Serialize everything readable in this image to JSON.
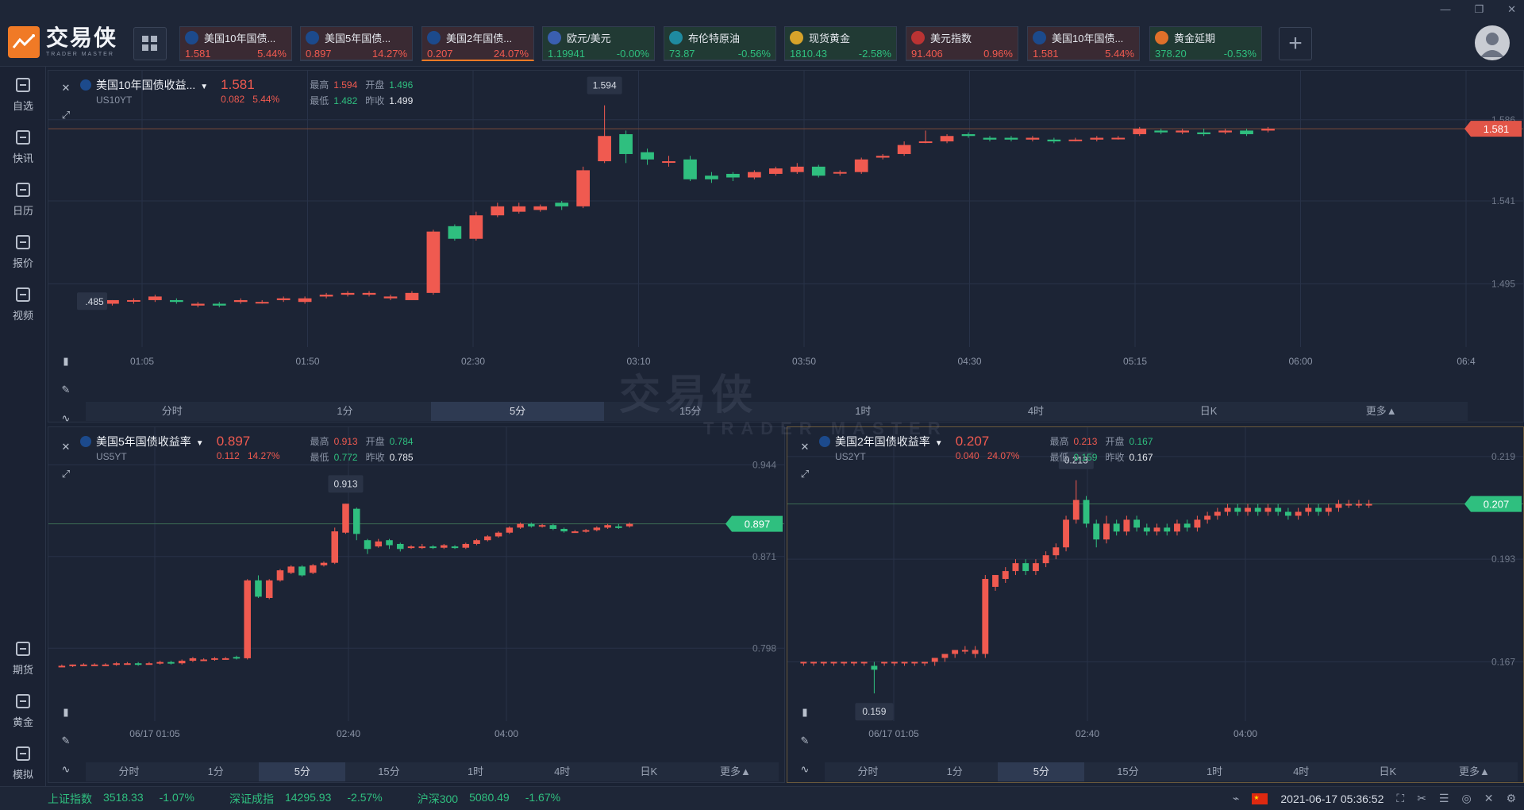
{
  "app": {
    "logo_cn": "交易侠",
    "logo_en": "TRADER MASTER",
    "watermark_cn": "交易侠",
    "watermark_en": "TRADER MASTER"
  },
  "tickers": [
    {
      "name": "美国10年国债...",
      "price": "1.581",
      "change": "5.44%",
      "dir": "up",
      "icon": "bar-chart-icon",
      "active": false
    },
    {
      "name": "美国5年国债...",
      "price": "0.897",
      "change": "14.27%",
      "dir": "up",
      "icon": "bar-chart-icon",
      "active": false
    },
    {
      "name": "美国2年国债...",
      "price": "0.207",
      "change": "24.07%",
      "dir": "up",
      "icon": "bar-chart-icon",
      "active": true
    },
    {
      "name": "欧元/美元",
      "price": "1.19941",
      "change": "-0.00%",
      "dir": "dn",
      "icon": "eu-us-flag-icon",
      "active": false
    },
    {
      "name": "布伦特原油",
      "price": "73.87",
      "change": "-0.56%",
      "dir": "dn",
      "icon": "oil-icon",
      "active": false
    },
    {
      "name": "现货黄金",
      "price": "1810.43",
      "change": "-2.58%",
      "dir": "dn",
      "icon": "gold-icon",
      "active": false
    },
    {
      "name": "美元指数",
      "price": "91.406",
      "change": "0.96%",
      "dir": "up",
      "icon": "us-flag-icon",
      "active": false
    },
    {
      "name": "美国10年国债...",
      "price": "1.581",
      "change": "5.44%",
      "dir": "up",
      "icon": "bar-chart-icon",
      "active": false
    },
    {
      "name": "黄金延期",
      "price": "378.20",
      "change": "-0.53%",
      "dir": "dn",
      "icon": "gold-bar-icon",
      "active": false
    }
  ],
  "sidebar_top": [
    {
      "label": "自选",
      "icon": "watchlist-icon"
    },
    {
      "label": "快讯",
      "icon": "news-icon"
    },
    {
      "label": "日历",
      "icon": "calendar-icon"
    },
    {
      "label": "报价",
      "icon": "quote-icon"
    },
    {
      "label": "视频",
      "icon": "video-icon"
    }
  ],
  "sidebar_bottom": [
    {
      "label": "期货",
      "icon": "futures-icon"
    },
    {
      "label": "黄金",
      "icon": "gold-icon"
    },
    {
      "label": "模拟",
      "icon": "simulate-icon"
    }
  ],
  "labels": {
    "high": "最高",
    "low": "最低",
    "open": "开盘",
    "prev": "昨收"
  },
  "panels": [
    {
      "title": "美国10年国债收益...",
      "code": "US10YT",
      "price": "1.581",
      "chg": "0.082",
      "pct": "5.44%",
      "high": "1.594",
      "low": "1.482",
      "open": "1.496",
      "prev": "1.499",
      "y_ticks": [
        "1.586",
        "1.541",
        "1.495"
      ],
      "x_ticks": [
        "01:05",
        "01:50",
        "02:30",
        "03:10",
        "03:50",
        "04:30",
        "05:15",
        "06:00",
        "06:4"
      ],
      "last_tag": "1.581",
      "high_tag": "1.594",
      "low_tag": ".485",
      "timeframes": [
        "分时",
        "1分",
        "5分",
        "15分",
        "1时",
        "4时",
        "日K",
        "更多▲"
      ],
      "selected_tf": "5分"
    },
    {
      "title": "美国5年国债收益率",
      "code": "US5YT",
      "price": "0.897",
      "chg": "0.112",
      "pct": "14.27%",
      "high": "0.913",
      "low": "0.772",
      "open": "0.784",
      "prev": "0.785",
      "y_ticks": [
        "0.944",
        "0.871",
        "0.798"
      ],
      "x_ticks": [
        "06/17 01:05",
        "02:40",
        "04:00"
      ],
      "last_tag": "0.897",
      "high_tag": "0.913",
      "low_tag": "",
      "timeframes": [
        "分时",
        "1分",
        "5分",
        "15分",
        "1时",
        "4时",
        "日K",
        "更多▲"
      ],
      "selected_tf": "5分"
    },
    {
      "title": "美国2年国债收益率",
      "code": "US2YT",
      "price": "0.207",
      "chg": "0.040",
      "pct": "24.07%",
      "high": "0.213",
      "low": "0.159",
      "open": "0.167",
      "prev": "0.167",
      "y_ticks": [
        "0.219",
        "0.193",
        "0.167"
      ],
      "x_ticks": [
        "06/17 01:05",
        "02:40",
        "04:00"
      ],
      "last_tag": "0.207",
      "high_tag": "0.213",
      "low_tag": "0.159",
      "timeframes": [
        "分时",
        "1分",
        "5分",
        "15分",
        "1时",
        "4时",
        "日K",
        "更多▲"
      ],
      "selected_tf": "5分"
    }
  ],
  "chart_data": [
    {
      "type": "candlestick",
      "title": "美国10年国债收益率",
      "ylim": [
        1.46,
        1.6
      ],
      "candles": [
        [
          1.483,
          1.484,
          1.483,
          1.485
        ],
        [
          1.484,
          1.486,
          1.483,
          1.486
        ],
        [
          1.486,
          1.486,
          1.484,
          1.487
        ],
        [
          1.486,
          1.488,
          1.485,
          1.489
        ],
        [
          1.486,
          1.485,
          1.484,
          1.487
        ],
        [
          1.483,
          1.484,
          1.482,
          1.485
        ],
        [
          1.484,
          1.483,
          1.482,
          1.485
        ],
        [
          1.485,
          1.486,
          1.484,
          1.487
        ],
        [
          1.485,
          1.485,
          1.484,
          1.486
        ],
        [
          1.486,
          1.487,
          1.485,
          1.488
        ],
        [
          1.485,
          1.487,
          1.484,
          1.488
        ],
        [
          1.488,
          1.489,
          1.487,
          1.49
        ],
        [
          1.489,
          1.49,
          1.488,
          1.491
        ],
        [
          1.489,
          1.49,
          1.488,
          1.491
        ],
        [
          1.487,
          1.488,
          1.486,
          1.489
        ],
        [
          1.486,
          1.49,
          1.486,
          1.491
        ],
        [
          1.49,
          1.524,
          1.489,
          1.525
        ],
        [
          1.527,
          1.52,
          1.519,
          1.528
        ],
        [
          1.52,
          1.533,
          1.519,
          1.535
        ],
        [
          1.533,
          1.538,
          1.532,
          1.54
        ],
        [
          1.535,
          1.538,
          1.534,
          1.54
        ],
        [
          1.536,
          1.538,
          1.535,
          1.539
        ],
        [
          1.54,
          1.538,
          1.536,
          1.541
        ],
        [
          1.538,
          1.558,
          1.537,
          1.56
        ],
        [
          1.563,
          1.577,
          1.562,
          1.594
        ],
        [
          1.578,
          1.567,
          1.562,
          1.58
        ],
        [
          1.568,
          1.564,
          1.561,
          1.57
        ],
        [
          1.563,
          1.563,
          1.56,
          1.566
        ],
        [
          1.564,
          1.553,
          1.552,
          1.566
        ],
        [
          1.555,
          1.553,
          1.551,
          1.557
        ],
        [
          1.556,
          1.554,
          1.552,
          1.557
        ],
        [
          1.554,
          1.557,
          1.553,
          1.558
        ],
        [
          1.556,
          1.559,
          1.555,
          1.56
        ],
        [
          1.557,
          1.56,
          1.556,
          1.562
        ],
        [
          1.56,
          1.555,
          1.554,
          1.561
        ],
        [
          1.557,
          1.557,
          1.555,
          1.558
        ],
        [
          1.557,
          1.564,
          1.556,
          1.565
        ],
        [
          1.565,
          1.566,
          1.564,
          1.567
        ],
        [
          1.567,
          1.572,
          1.566,
          1.574
        ],
        [
          1.574,
          1.574,
          1.573,
          1.58
        ],
        [
          1.574,
          1.577,
          1.573,
          1.578
        ],
        [
          1.578,
          1.577,
          1.576,
          1.579
        ],
        [
          1.576,
          1.575,
          1.574,
          1.577
        ],
        [
          1.576,
          1.575,
          1.574,
          1.577
        ],
        [
          1.575,
          1.576,
          1.574,
          1.577
        ],
        [
          1.575,
          1.574,
          1.573,
          1.576
        ],
        [
          1.575,
          1.575,
          1.574,
          1.576
        ],
        [
          1.575,
          1.576,
          1.574,
          1.577
        ],
        [
          1.576,
          1.576,
          1.575,
          1.577
        ],
        [
          1.578,
          1.581,
          1.577,
          1.582
        ],
        [
          1.58,
          1.579,
          1.578,
          1.581
        ],
        [
          1.579,
          1.58,
          1.578,
          1.581
        ],
        [
          1.579,
          1.578,
          1.577,
          1.581
        ],
        [
          1.579,
          1.58,
          1.578,
          1.581
        ],
        [
          1.58,
          1.578,
          1.577,
          1.581
        ],
        [
          1.58,
          1.581,
          1.579,
          1.582
        ]
      ]
    },
    {
      "type": "candlestick",
      "title": "美国5年国债收益率",
      "ylim": [
        0.74,
        0.96
      ],
      "candles": [
        [
          0.784,
          0.784,
          0.783,
          0.785
        ],
        [
          0.784,
          0.785,
          0.783,
          0.785
        ],
        [
          0.785,
          0.785,
          0.784,
          0.786
        ],
        [
          0.784,
          0.785,
          0.784,
          0.786
        ],
        [
          0.785,
          0.785,
          0.784,
          0.786
        ],
        [
          0.785,
          0.786,
          0.784,
          0.787
        ],
        [
          0.786,
          0.786,
          0.785,
          0.787
        ],
        [
          0.786,
          0.785,
          0.784,
          0.787
        ],
        [
          0.786,
          0.786,
          0.785,
          0.787
        ],
        [
          0.786,
          0.787,
          0.785,
          0.788
        ],
        [
          0.787,
          0.786,
          0.785,
          0.788
        ],
        [
          0.786,
          0.788,
          0.785,
          0.789
        ],
        [
          0.788,
          0.79,
          0.787,
          0.791
        ],
        [
          0.789,
          0.789,
          0.788,
          0.79
        ],
        [
          0.789,
          0.79,
          0.788,
          0.791
        ],
        [
          0.79,
          0.79,
          0.789,
          0.791
        ],
        [
          0.791,
          0.79,
          0.789,
          0.792
        ],
        [
          0.79,
          0.852,
          0.789,
          0.853
        ],
        [
          0.852,
          0.839,
          0.838,
          0.856
        ],
        [
          0.838,
          0.852,
          0.837,
          0.853
        ],
        [
          0.852,
          0.86,
          0.851,
          0.861
        ],
        [
          0.858,
          0.863,
          0.857,
          0.864
        ],
        [
          0.863,
          0.856,
          0.855,
          0.864
        ],
        [
          0.858,
          0.864,
          0.857,
          0.865
        ],
        [
          0.864,
          0.866,
          0.863,
          0.867
        ],
        [
          0.866,
          0.891,
          0.865,
          0.894
        ],
        [
          0.89,
          0.913,
          0.889,
          0.913
        ],
        [
          0.909,
          0.889,
          0.884,
          0.91
        ],
        [
          0.884,
          0.877,
          0.873,
          0.885
        ],
        [
          0.879,
          0.883,
          0.878,
          0.885
        ],
        [
          0.884,
          0.88,
          0.877,
          0.885
        ],
        [
          0.881,
          0.877,
          0.875,
          0.882
        ],
        [
          0.878,
          0.879,
          0.877,
          0.88
        ],
        [
          0.878,
          0.879,
          0.877,
          0.881
        ],
        [
          0.879,
          0.878,
          0.877,
          0.88
        ],
        [
          0.878,
          0.88,
          0.877,
          0.881
        ],
        [
          0.879,
          0.878,
          0.877,
          0.88
        ],
        [
          0.878,
          0.881,
          0.877,
          0.882
        ],
        [
          0.881,
          0.884,
          0.88,
          0.885
        ],
        [
          0.884,
          0.887,
          0.883,
          0.888
        ],
        [
          0.887,
          0.89,
          0.886,
          0.891
        ],
        [
          0.89,
          0.894,
          0.889,
          0.895
        ],
        [
          0.894,
          0.897,
          0.893,
          0.898
        ],
        [
          0.897,
          0.895,
          0.894,
          0.898
        ],
        [
          0.895,
          0.896,
          0.894,
          0.897
        ],
        [
          0.896,
          0.893,
          0.892,
          0.897
        ],
        [
          0.893,
          0.891,
          0.89,
          0.894
        ],
        [
          0.891,
          0.891,
          0.89,
          0.892
        ],
        [
          0.891,
          0.892,
          0.89,
          0.893
        ],
        [
          0.892,
          0.894,
          0.891,
          0.895
        ],
        [
          0.894,
          0.896,
          0.893,
          0.897
        ],
        [
          0.895,
          0.894,
          0.893,
          0.897
        ],
        [
          0.895,
          0.897,
          0.894,
          0.898
        ]
      ]
    },
    {
      "type": "candlestick",
      "title": "美国2年国债收益率",
      "ylim": [
        0.152,
        0.222
      ],
      "candles": [
        [
          0.167,
          0.167,
          0.166,
          0.167
        ],
        [
          0.167,
          0.167,
          0.166,
          0.167
        ],
        [
          0.167,
          0.167,
          0.166,
          0.167
        ],
        [
          0.167,
          0.167,
          0.166,
          0.167
        ],
        [
          0.167,
          0.167,
          0.166,
          0.167
        ],
        [
          0.167,
          0.167,
          0.166,
          0.167
        ],
        [
          0.167,
          0.167,
          0.166,
          0.167
        ],
        [
          0.166,
          0.165,
          0.159,
          0.167
        ],
        [
          0.167,
          0.167,
          0.166,
          0.167
        ],
        [
          0.167,
          0.167,
          0.166,
          0.167
        ],
        [
          0.167,
          0.167,
          0.166,
          0.167
        ],
        [
          0.167,
          0.167,
          0.166,
          0.167
        ],
        [
          0.167,
          0.167,
          0.166,
          0.167
        ],
        [
          0.167,
          0.168,
          0.166,
          0.168
        ],
        [
          0.168,
          0.169,
          0.167,
          0.169
        ],
        [
          0.169,
          0.17,
          0.168,
          0.17
        ],
        [
          0.17,
          0.17,
          0.169,
          0.171
        ],
        [
          0.169,
          0.17,
          0.168,
          0.171
        ],
        [
          0.169,
          0.188,
          0.168,
          0.189
        ],
        [
          0.186,
          0.189,
          0.185,
          0.189
        ],
        [
          0.188,
          0.19,
          0.187,
          0.191
        ],
        [
          0.19,
          0.192,
          0.189,
          0.193
        ],
        [
          0.192,
          0.19,
          0.189,
          0.193
        ],
        [
          0.19,
          0.192,
          0.189,
          0.193
        ],
        [
          0.192,
          0.194,
          0.191,
          0.195
        ],
        [
          0.194,
          0.196,
          0.193,
          0.197
        ],
        [
          0.196,
          0.203,
          0.195,
          0.204
        ],
        [
          0.203,
          0.208,
          0.202,
          0.213
        ],
        [
          0.208,
          0.202,
          0.201,
          0.209
        ],
        [
          0.202,
          0.198,
          0.196,
          0.203
        ],
        [
          0.198,
          0.202,
          0.197,
          0.204
        ],
        [
          0.202,
          0.2,
          0.199,
          0.203
        ],
        [
          0.2,
          0.203,
          0.199,
          0.204
        ],
        [
          0.203,
          0.201,
          0.2,
          0.204
        ],
        [
          0.201,
          0.2,
          0.199,
          0.202
        ],
        [
          0.2,
          0.201,
          0.199,
          0.202
        ],
        [
          0.201,
          0.2,
          0.199,
          0.202
        ],
        [
          0.2,
          0.202,
          0.199,
          0.203
        ],
        [
          0.202,
          0.201,
          0.2,
          0.203
        ],
        [
          0.201,
          0.203,
          0.2,
          0.204
        ],
        [
          0.203,
          0.204,
          0.202,
          0.205
        ],
        [
          0.204,
          0.205,
          0.203,
          0.206
        ],
        [
          0.205,
          0.206,
          0.204,
          0.207
        ],
        [
          0.206,
          0.205,
          0.204,
          0.207
        ],
        [
          0.205,
          0.206,
          0.204,
          0.207
        ],
        [
          0.206,
          0.205,
          0.204,
          0.207
        ],
        [
          0.205,
          0.206,
          0.204,
          0.207
        ],
        [
          0.206,
          0.205,
          0.204,
          0.207
        ],
        [
          0.205,
          0.204,
          0.203,
          0.206
        ],
        [
          0.204,
          0.205,
          0.203,
          0.206
        ],
        [
          0.205,
          0.206,
          0.204,
          0.207
        ],
        [
          0.206,
          0.205,
          0.204,
          0.207
        ],
        [
          0.205,
          0.206,
          0.204,
          0.207
        ],
        [
          0.206,
          0.207,
          0.205,
          0.208
        ],
        [
          0.207,
          0.207,
          0.206,
          0.208
        ],
        [
          0.207,
          0.207,
          0.206,
          0.208
        ],
        [
          0.207,
          0.207,
          0.206,
          0.208
        ]
      ]
    }
  ],
  "status": {
    "indices": [
      {
        "name": "上证指数",
        "value": "3518.33",
        "pct": "-1.07%"
      },
      {
        "name": "深证成指",
        "value": "14295.93",
        "pct": "-2.57%"
      },
      {
        "name": "沪深300",
        "value": "5080.49",
        "pct": "-1.67%"
      }
    ],
    "datetime": "2021-06-17 05:36:52"
  },
  "colors": {
    "up": "#f05a50",
    "down": "#2fbf7f",
    "accent": "#f07a26"
  }
}
